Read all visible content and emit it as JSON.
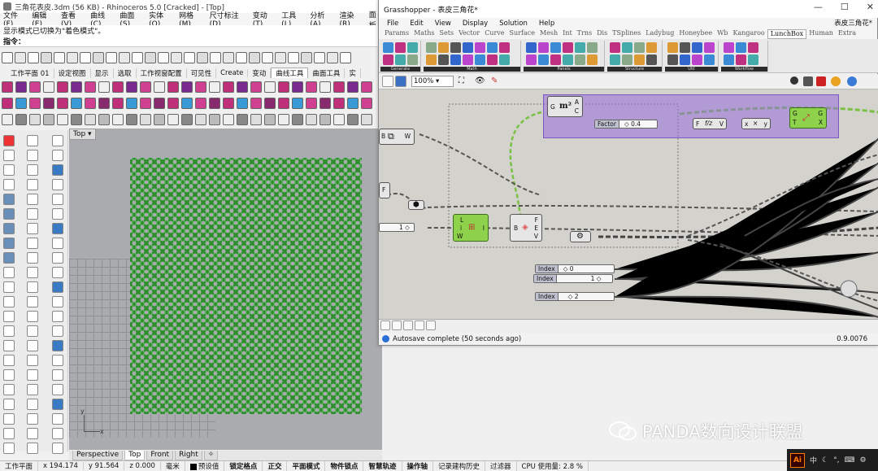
{
  "rhino": {
    "title": "三角花表皮.3dm (56 KB) - Rhinoceros 5.0 [Cracked] - [Top]",
    "menu": [
      "文件(F)",
      "编辑(E)",
      "查看(V)",
      "曲线(C)",
      "曲面(S)",
      "实体(O)",
      "网格(M)",
      "尺寸标注(D)",
      "变动(T)",
      "工具(L)",
      "分析(A)",
      "渲染(R)",
      "面板"
    ],
    "command_log": "显示模式已切换为\"着色模式\"。",
    "command_prompt": "指令：",
    "tabs": [
      "工作平面 01",
      "设定视图",
      "显示",
      "选取",
      "工作视窗配置",
      "可见性",
      "Create",
      "变动",
      "曲线工具",
      "曲面工具",
      "实"
    ],
    "active_tab_index": 8,
    "viewport_label": "Top",
    "viewport_tabs": [
      "Perspective",
      "Top",
      "Front",
      "Right",
      "✧"
    ],
    "active_viewport_tab": 1,
    "axis": {
      "x": "x",
      "y": "y"
    },
    "pattern_color": "#2c8f2c"
  },
  "status": {
    "plane": "工作平面",
    "x": "x 194.174",
    "y": "y 91.564",
    "z": "z 0.000",
    "unit": "毫米",
    "layer": "预设值",
    "osnap": "锁定格点",
    "ortho": "正交",
    "planar": "平面模式",
    "objsnap": "物件锁点",
    "smarttrack": "智慧轨迹",
    "gumball": "操作轴",
    "history": "记录建构历史",
    "filter": "过滤器",
    "cpu": "CPU 使用量: 2.8 %"
  },
  "grasshopper": {
    "title": "Grasshopper - 表皮三角花*",
    "window_buttons": [
      "—",
      "☐",
      "✕"
    ],
    "menu": [
      "File",
      "Edit",
      "View",
      "Display",
      "Solution",
      "Help"
    ],
    "doc_tab": "表皮三角花*",
    "component_tabs": [
      "Params",
      "Maths",
      "Sets",
      "Vector",
      "Curve",
      "Surface",
      "Mesh",
      "Int",
      "Trns",
      "Dis",
      "TSplines",
      "Ladybug",
      "Honeybee",
      "Wb",
      "Kangaroo",
      "LunchBox",
      "Human",
      "Extra"
    ],
    "active_component_tab": 15,
    "ribbon_groups": [
      "Generate",
      "Math",
      "Panels",
      "Structure",
      "Util",
      "Workflow"
    ],
    "zoom": "100%",
    "status": "Autosave complete (50 seconds ago)",
    "version": "0.9.0076",
    "nodes": {
      "area": {
        "left": "G",
        "icon": "m²",
        "out1": "A",
        "out2": "C"
      },
      "factor_slider": {
        "label": "Factor",
        "value": "◇ 0.4"
      },
      "fvec": {
        "left": "F",
        "icon": "f/z",
        "right": "V"
      },
      "mul": {
        "left": "x",
        "icon": "×",
        "right": "y"
      },
      "green_top": {
        "in1": "G",
        "in2": "T",
        "out1": "G",
        "out2": "X"
      },
      "bw": {
        "left": "B",
        "right": "W"
      },
      "f_small": "F",
      "slider1": {
        "value": "1 ◇"
      },
      "lii": {
        "in1": "L",
        "in2": "i",
        "in3": "W",
        "out": "I"
      },
      "bfev": {
        "left": "B",
        "out1": "F",
        "out2": "E",
        "out3": "V"
      },
      "index0": {
        "label": "Index",
        "value": "◇ 0"
      },
      "index1": {
        "label": "Index",
        "value": "1 ◇"
      },
      "index2": {
        "label": "Index",
        "value": "◇ 2"
      }
    }
  },
  "watermark": "PANDA数向设计联盟",
  "taskbar": {
    "app": "Ai",
    "ime": "中"
  }
}
